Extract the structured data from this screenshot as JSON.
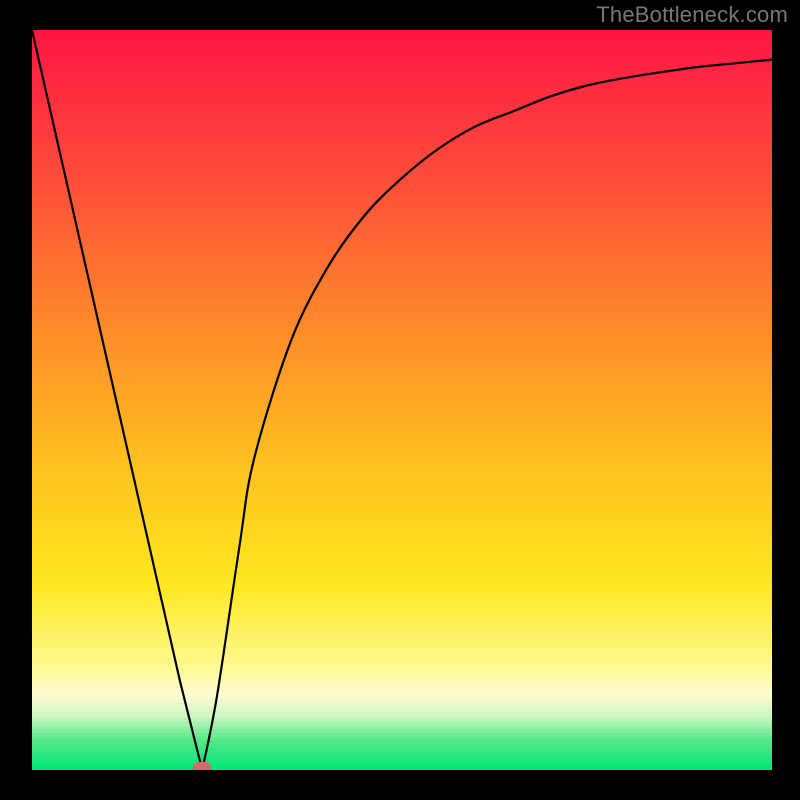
{
  "attribution": "TheBottleneck.com",
  "chart_data": {
    "type": "line",
    "title": "",
    "xlabel": "",
    "ylabel": "",
    "xlim": [
      0,
      100
    ],
    "ylim": [
      0,
      100
    ],
    "x": [
      0,
      5,
      10,
      15,
      20,
      23,
      25,
      28,
      30,
      35,
      40,
      45,
      50,
      55,
      60,
      65,
      70,
      75,
      80,
      85,
      90,
      95,
      100
    ],
    "values": [
      100,
      78,
      56,
      34,
      12,
      0,
      10,
      30,
      42,
      58,
      68,
      75,
      80,
      84,
      87,
      89,
      91,
      92.5,
      93.5,
      94.3,
      95,
      95.5,
      96
    ],
    "marker": {
      "x": 23,
      "y": 0
    },
    "gradient_stops": [
      {
        "pos": 0.0,
        "color": "#ff1744"
      },
      {
        "pos": 0.2,
        "color": "#ff4d3a"
      },
      {
        "pos": 0.4,
        "color": "#ff8a2a"
      },
      {
        "pos": 0.58,
        "color": "#ffbf1f"
      },
      {
        "pos": 0.75,
        "color": "#ffe81f"
      },
      {
        "pos": 0.86,
        "color": "#fff98f"
      },
      {
        "pos": 0.9,
        "color": "#fffcd0"
      },
      {
        "pos": 0.93,
        "color": "#c9f7c2"
      },
      {
        "pos": 0.96,
        "color": "#5ce88a"
      },
      {
        "pos": 1.0,
        "color": "#00e676"
      }
    ]
  }
}
